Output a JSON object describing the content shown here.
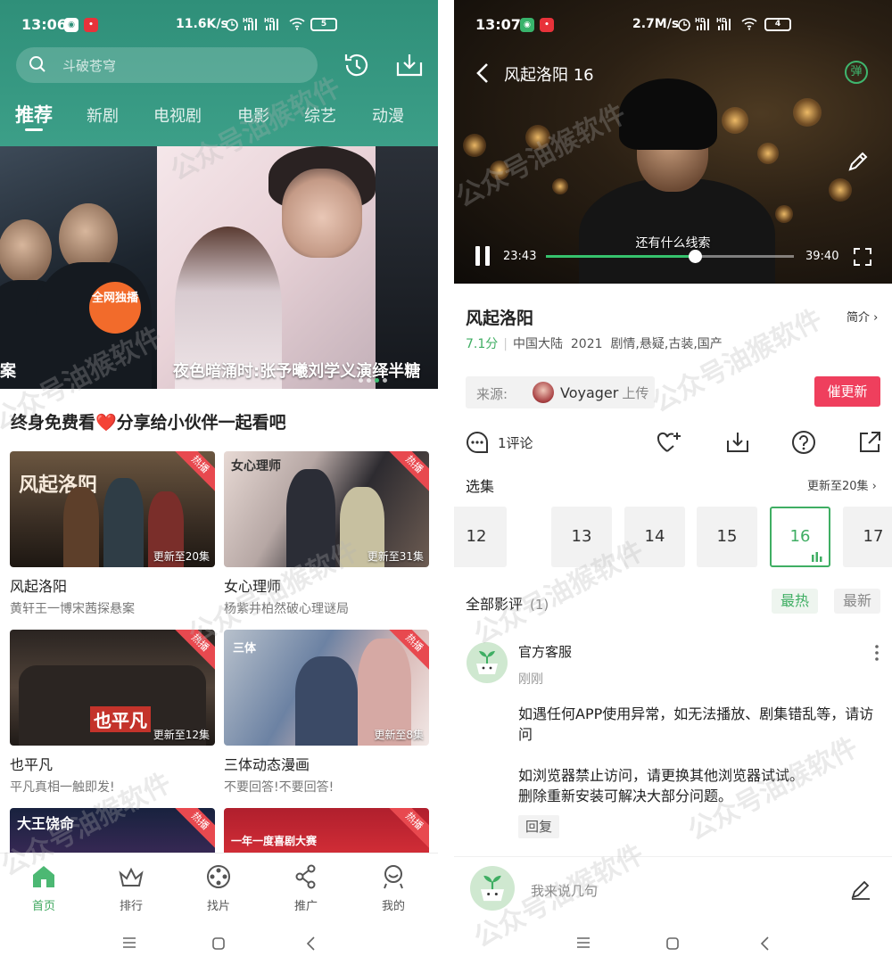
{
  "left": {
    "status": {
      "time": "13:06",
      "speed": "11.6K/s",
      "battery": "5",
      "signals": "HD ᵢₗₗ HD ᵢₗₗ"
    },
    "search": {
      "placeholder": "斗破苍穹"
    },
    "tabs": [
      "推荐",
      "新剧",
      "电视剧",
      "电影",
      "综艺",
      "动漫"
    ],
    "active_tab": "推荐",
    "banner": {
      "left_caption": "案",
      "left_badge": "全网独播",
      "right_caption": "夜色暗涌时:张予曦刘学义演绎半糖"
    },
    "promo_text": "终身免费看❤️分享给小伙伴一起看吧",
    "hot_label": "热播",
    "cards": [
      {
        "title": "风起洛阳",
        "sub": "黄轩王一博宋茜探悬案",
        "update": "更新至20集",
        "art": "风起洛阳"
      },
      {
        "title": "女心理师",
        "sub": "杨紫井柏然破心理谜局",
        "update": "更新至31集",
        "art": "女心理师"
      },
      {
        "title": "也平凡",
        "sub": "平凡真相一触即发!",
        "update": "更新至12集",
        "art": "也平凡"
      },
      {
        "title": "三体动态漫画",
        "sub": "不要回答!不要回答!",
        "update": "更新至8集",
        "art": "三体"
      },
      {
        "title": "",
        "sub": "",
        "update": "",
        "art": "大王饶命"
      },
      {
        "title": "",
        "sub": "",
        "update": "",
        "art": "一年一度喜剧大赛"
      }
    ],
    "bottom_nav": [
      "首页",
      "排行",
      "找片",
      "推广",
      "我的"
    ],
    "active_nav": "首页"
  },
  "right": {
    "status": {
      "time": "13:07",
      "speed": "2.7M/s",
      "battery": "4"
    },
    "player": {
      "title": "风起洛阳 16",
      "danmu_label": "弹",
      "subtitle": "还有什么线索",
      "current_time": "23:43",
      "total_time": "39:40",
      "progress": 0.6
    },
    "show": {
      "title": "风起洛阳",
      "intro_label": "简介 ›",
      "score": "7.1分",
      "region": "中国大陆",
      "year": "2021",
      "genres": "剧情,悬疑,古装,国产"
    },
    "source": {
      "label": "来源:",
      "user": "Voyager",
      "suffix": "上传"
    },
    "urge_button": "催更新",
    "comment_count_label": "1评论",
    "episodes": {
      "header": "选集",
      "update_info": "更新至20集 ›",
      "items": [
        "12",
        "13",
        "14",
        "15",
        "16",
        "17"
      ],
      "current": "16"
    },
    "reviews": {
      "header": "全部影评",
      "count": "(1)",
      "hot_tab": "最热",
      "new_tab": "最新"
    },
    "comment": {
      "author": "官方客服",
      "time": "刚刚",
      "lines": [
        "如遇任何APP使用异常，如无法播放、剧集错乱等，请访问",
        "如浏览器禁止访问，请更换其他浏览器试试。",
        "删除重新安装可解决大部分问题。"
      ],
      "reply_label": "回复"
    },
    "input_placeholder": "我来说几句"
  },
  "watermark": "公众号油猴软件",
  "colors": {
    "header_green": "#3c9f88",
    "accent_green": "#3fae63",
    "hot_red": "#e8494f",
    "urge_red": "#ef3f5d"
  }
}
